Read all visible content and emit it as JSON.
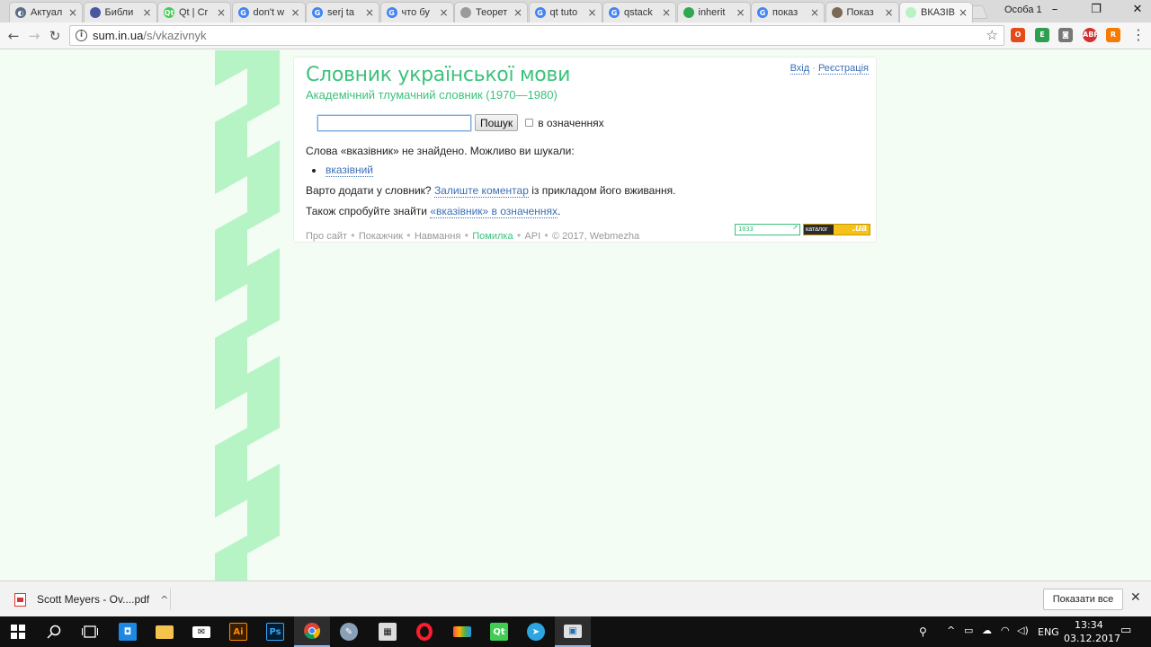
{
  "browser": {
    "tabs": [
      {
        "label": "Актуал",
        "favicon_color": "#5a6e8a",
        "favicon_char": "◐"
      },
      {
        "label": "Библи",
        "favicon_color": "#4a56a0",
        "favicon_char": ""
      },
      {
        "label": "Qt | Cr",
        "favicon_color": "#41cd52",
        "favicon_char": "Qt"
      },
      {
        "label": "don't w",
        "favicon_color": "#4285f4",
        "favicon_char": "G"
      },
      {
        "label": "serj ta",
        "favicon_color": "#4285f4",
        "favicon_char": "G"
      },
      {
        "label": "что бу",
        "favicon_color": "#4285f4",
        "favicon_char": "G"
      },
      {
        "label": "Теорет",
        "favicon_color": "#9a9a9a",
        "favicon_char": ""
      },
      {
        "label": "qt tuto",
        "favicon_color": "#4285f4",
        "favicon_char": "G"
      },
      {
        "label": "qstack",
        "favicon_color": "#4285f4",
        "favicon_char": "G"
      },
      {
        "label": "inherit",
        "favicon_color": "#2fa84f",
        "favicon_char": ""
      },
      {
        "label": "показ",
        "favicon_color": "#4285f4",
        "favicon_char": "G"
      },
      {
        "label": "Показ",
        "favicon_color": "#7a6a55",
        "favicon_char": ""
      },
      {
        "label": "ВКАЗІВ",
        "favicon_color": "#b6f4c5",
        "favicon_char": ""
      }
    ],
    "profile_name": "Особа 1",
    "window_controls": {
      "minimize": "–",
      "restore": "❐",
      "close": "✕"
    },
    "url": {
      "host": "sum.in.ua",
      "path": "/s/vkazivnyk"
    }
  },
  "page": {
    "title": "Словник української мови",
    "subtitle": "Академічний тлумачний словник (1970—1980)",
    "auth": {
      "login": "Вхід",
      "separator": "·",
      "register": "Реєстрація"
    },
    "search": {
      "value": "",
      "button": "Пошук",
      "checkbox_label": "в означеннях"
    },
    "not_found": "Слова «вказівник» не знайдено. Можливо ви шукали:",
    "suggestions": [
      "вказівний"
    ],
    "add_prompt": {
      "before": "Варто додати у словник?",
      "link": "Залиште коментар",
      "after": "із прикладом його вживання."
    },
    "try_prompt": {
      "before": "Також спробуйте знайти",
      "link": "«вказівник» в означеннях",
      "after": "."
    },
    "footer": {
      "links": [
        "Про сайт",
        "Покажчик",
        "Навмання",
        "Помилка",
        "API"
      ],
      "copyright": "© 2017, Webmezha"
    },
    "badges": {
      "counter": "1033",
      "catalog": "каталог",
      "catalog_domain": ".ua"
    }
  },
  "downloads": {
    "file": "Scott Meyers - Ov....pdf",
    "show_all": "Показати все"
  },
  "taskbar": {
    "tray": {
      "lang": "ENG",
      "time": "13:34",
      "date": "03.12.2017"
    }
  }
}
